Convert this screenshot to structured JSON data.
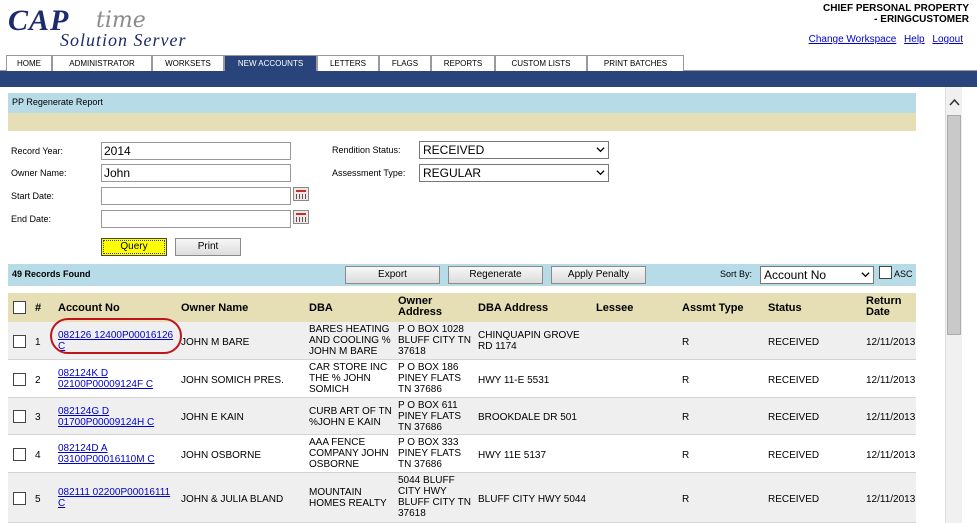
{
  "header": {
    "logo_cap": "CAP",
    "logo_time": "time",
    "logo_sub": "Solution Server",
    "user_line1": "CHIEF  PERSONAL PROPERTY",
    "user_line2": "- ERINGCUSTOMER",
    "links": [
      "Change Workspace",
      "Help",
      "Logout"
    ]
  },
  "nav": {
    "tabs": [
      "HOME",
      "ADMINISTRATOR",
      "WORKSETS",
      "NEW ACCOUNTS",
      "LETTERS",
      "FLAGS",
      "REPORTS",
      "CUSTOM LISTS",
      "PRINT BATCHES"
    ],
    "active": "NEW ACCOUNTS"
  },
  "form": {
    "section_title": "PP Regenerate Report",
    "record_year_label": "Record Year:",
    "record_year_value": "2014",
    "owner_name_label": "Owner Name:",
    "owner_name_value": "John",
    "start_date_label": "Start Date:",
    "end_date_label": "End Date:",
    "rendition_status_label": "Rendition Status:",
    "rendition_status_value": "RECEIVED",
    "assessment_type_label": "Assessment Type:",
    "assessment_type_value": "REGULAR",
    "query_label": "Query",
    "print_label": "Print"
  },
  "results": {
    "count_text": "49 Records Found",
    "export_label": "Export",
    "regenerate_label": "Regenerate",
    "apply_penalty_label": "Apply Penalty",
    "sort_by_label": "Sort By:",
    "sort_by_value": "Account No",
    "asc_label": "ASC"
  },
  "table": {
    "headers": [
      "#",
      "Account No",
      "Owner Name",
      "DBA",
      "Owner Address",
      "DBA Address",
      "Lessee",
      "Assmt Type",
      "Status",
      "Return Date"
    ],
    "rows": [
      {
        "num": "1",
        "account": [
          "082126 12400P00016126",
          "C"
        ],
        "owner": "JOHN M BARE",
        "dba": [
          "BARES HEATING",
          "AND COOLING %",
          "JOHN M BARE"
        ],
        "address": [
          "P O BOX 1028",
          "BLUFF CITY TN",
          "37618"
        ],
        "dba_address": [
          "CHINQUAPIN GROVE",
          "RD 1174"
        ],
        "lessee": "",
        "assmt": "R",
        "status": "RECEIVED",
        "date": "12/11/2013"
      },
      {
        "num": "2",
        "account": [
          "082124K D",
          "02100P00009124F C"
        ],
        "owner": "JOHN SOMICH PRES.",
        "dba": [
          "CAR STORE INC",
          "THE % JOHN",
          "SOMICH"
        ],
        "address": [
          "P O BOX 186",
          "PINEY FLATS",
          "TN 37686"
        ],
        "dba_address": [
          "HWY 11-E 5531"
        ],
        "lessee": "",
        "assmt": "R",
        "status": "RECEIVED",
        "date": "12/11/2013"
      },
      {
        "num": "3",
        "account": [
          "082124G D",
          "01700P00009124H C"
        ],
        "owner": "JOHN E KAIN",
        "dba": [
          "CURB ART OF TN",
          "%JOHN E KAIN"
        ],
        "address": [
          "P O BOX 611",
          "PINEY FLATS",
          "TN 37686"
        ],
        "dba_address": [
          "BROOKDALE DR 501"
        ],
        "lessee": "",
        "assmt": "R",
        "status": "RECEIVED",
        "date": "12/11/2013"
      },
      {
        "num": "4",
        "account": [
          "082124D A",
          "03100P00016110M C"
        ],
        "owner": "JOHN OSBORNE",
        "dba": [
          "AAA FENCE",
          "COMPANY JOHN",
          "OSBORNE"
        ],
        "address": [
          "P O BOX 333",
          "PINEY FLATS",
          "TN 37686"
        ],
        "dba_address": [
          "HWY 11E 5137"
        ],
        "lessee": "",
        "assmt": "R",
        "status": "RECEIVED",
        "date": "12/11/2013"
      },
      {
        "num": "5",
        "account": [
          "082111 02200P00016111",
          "C"
        ],
        "owner": "JOHN & JULIA BLAND",
        "dba": [
          "MOUNTAIN",
          "HOMES REALTY"
        ],
        "address": [
          "5044 BLUFF",
          "CITY HWY",
          "BLUFF CITY TN",
          "37618"
        ],
        "dba_address": [
          "BLUFF CITY HWY 5044"
        ],
        "lessee": "",
        "assmt": "R",
        "status": "RECEIVED",
        "date": "12/11/2013"
      }
    ]
  }
}
